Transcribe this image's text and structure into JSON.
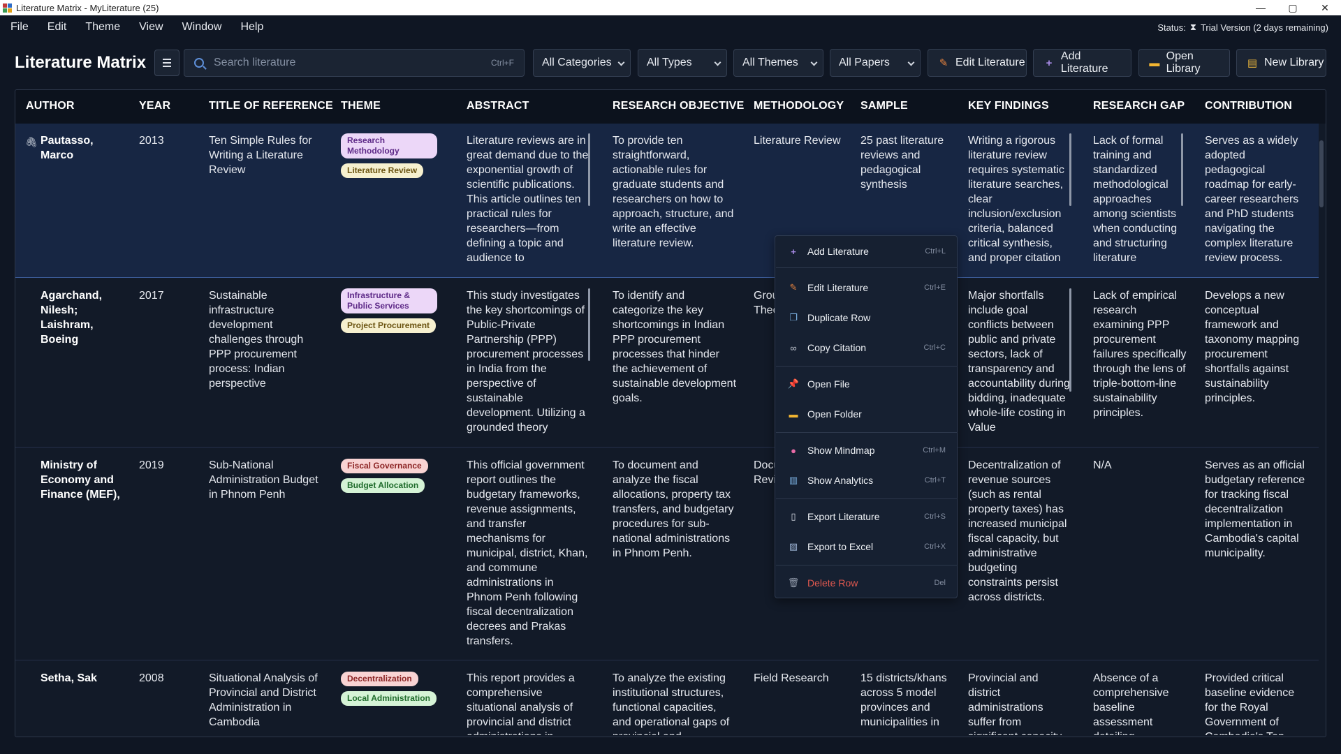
{
  "window": {
    "title": "Literature Matrix - MyLiterature (25)",
    "controls": {
      "minimize": "—",
      "maximize": "▢",
      "close": "✕"
    }
  },
  "menubar": {
    "items": [
      "File",
      "Edit",
      "Theme",
      "View",
      "Window",
      "Help"
    ],
    "status_label": "Status:",
    "status_value": "Trial Version (2 days remaining)"
  },
  "toolbar": {
    "title": "Literature Matrix",
    "search_placeholder": "Search literature",
    "search_shortcut": "Ctrl+F",
    "filters": [
      "All Categories",
      "All Types",
      "All Themes",
      "All Papers"
    ],
    "buttons": {
      "edit": "Edit Literature",
      "add": "Add Literature",
      "open_library": "Open Library",
      "new_library": "New Library"
    }
  },
  "table": {
    "headers": [
      "AUTHOR",
      "YEAR",
      "TITLE OF REFERENCE",
      "THEME",
      "ABSTRACT",
      "RESEARCH OBJECTIVE",
      "METHODOLOGY",
      "SAMPLE",
      "KEY FINDINGS",
      "RESEARCH GAP",
      "CONTRIBUTION"
    ],
    "rows": [
      {
        "author": "Pautasso, Marco",
        "year": "2013",
        "title": "Ten Simple Rules for Writing a Literature Review",
        "themes": [
          {
            "label": "Research Methodology",
            "color": "purple"
          },
          {
            "label": "Literature Review",
            "color": "cream"
          }
        ],
        "abstract": "Literature reviews are in great demand due to the exponential growth of scientific publications. This article outlines ten practical rules for researchers—from defining a topic and audience to",
        "objective": "To provide ten straightforward, actionable rules for graduate students and researchers on how to approach, structure, and write an effective literature review.",
        "methodology": "Literature Review",
        "sample": "25 past literature reviews and pedagogical synthesis",
        "findings": "Writing a rigorous literature review requires systematic literature searches, clear inclusion/exclusion criteria, balanced critical synthesis, and proper citation",
        "gap": "Lack of formal training and standardized methodological approaches among scientists when conducting and structuring literature",
        "contribution": "Serves as a widely adopted pedagogical roadmap for early-career researchers and PhD students navigating the complex literature review process."
      },
      {
        "author": "Agarchand, Nilesh; Laishram, Boeing",
        "year": "2017",
        "title": "Sustainable infrastructure development challenges through PPP procurement process: Indian perspective",
        "themes": [
          {
            "label": "Infrastructure & Public Services",
            "color": "purple"
          },
          {
            "label": "Project Procurement",
            "color": "cream"
          }
        ],
        "abstract": "This study investigates the key shortcomings of Public-Private Partnership (PPP) procurement processes in India from the perspective of sustainable development. Utilizing a grounded theory",
        "objective": "To identify and categorize the key shortcomings in Indian PPP procurement processes that hinder the achievement of sustainable development goals.",
        "methodology": "Grou Theo",
        "sample": "",
        "findings": "Major shortfalls include goal conflicts between public and private sectors, lack of transparency and accountability during bidding, inadequate whole-life costing in Value",
        "gap": "Lack of empirical research examining PPP procurement failures specifically through the lens of triple-bottom-line sustainability principles.",
        "contribution": "Develops a new conceptual framework and taxonomy mapping procurement shortfalls against sustainability principles."
      },
      {
        "author": "Ministry of Economy and Finance (MEF),",
        "year": "2019",
        "title": "Sub-National Administration Budget in Phnom Penh",
        "themes": [
          {
            "label": "Fiscal Governance",
            "color": "red"
          },
          {
            "label": "Budget Allocation",
            "color": "green"
          }
        ],
        "abstract": "This official government report outlines the budgetary frameworks, revenue assignments, and transfer mechanisms for municipal, district, Khan, and commune administrations in Phnom Penh following fiscal decentralization decrees and Prakas transfers.",
        "objective": "To document and analyze the fiscal allocations, property tax transfers, and budgetary procedures for sub-national administrations in Phnom Penh.",
        "methodology": "Docu Revi",
        "sample": "",
        "findings": "Decentralization of revenue sources (such as rental property taxes) has increased municipal fiscal capacity, but administrative budgeting constraints persist across districts.",
        "gap": "N/A",
        "contribution": "Serves as an official budgetary reference for tracking fiscal decentralization implementation in Cambodia's capital municipality."
      },
      {
        "author": "Setha, Sak",
        "year": "2008",
        "title": "Situational Analysis of Provincial and District Administration in Cambodia",
        "themes": [
          {
            "label": "Decentralization",
            "color": "red"
          },
          {
            "label": "Local Administration",
            "color": "green"
          }
        ],
        "abstract": "This report provides a comprehensive situational analysis of provincial and district administrations in",
        "objective": "To analyze the existing institutional structures, functional capacities, and operational gaps of provincial and",
        "methodology": "Field Research",
        "sample": "15 districts/khans across 5 model provinces and municipalities in",
        "findings": "Provincial and district administrations suffer from significant capacity",
        "gap": "Absence of a comprehensive baseline assessment detailing",
        "contribution": "Provided critical baseline evidence for the Royal Government of Cambodia's Top"
      }
    ]
  },
  "context_menu": {
    "items": [
      {
        "label": "Add Literature",
        "shortcut": "Ctrl+L",
        "icon": "plus-icon"
      },
      {
        "label": "Edit Literature",
        "shortcut": "Ctrl+E",
        "icon": "pencil-icon"
      },
      {
        "label": "Duplicate Row",
        "shortcut": "",
        "icon": "duplicate-icon"
      },
      {
        "label": "Copy Citation",
        "shortcut": "Ctrl+C",
        "icon": "link-icon"
      },
      {
        "label": "Open File",
        "shortcut": "",
        "icon": "pin-icon"
      },
      {
        "label": "Open Folder",
        "shortcut": "",
        "icon": "folder-icon"
      },
      {
        "label": "Show Mindmap",
        "shortcut": "Ctrl+M",
        "icon": "mindmap-icon"
      },
      {
        "label": "Show Analytics",
        "shortcut": "Ctrl+T",
        "icon": "chart-icon"
      },
      {
        "label": "Export Literature",
        "shortcut": "Ctrl+S",
        "icon": "document-icon"
      },
      {
        "label": "Export to Excel",
        "shortcut": "Ctrl+X",
        "icon": "spreadsheet-icon"
      },
      {
        "label": "Delete Row",
        "shortcut": "Del",
        "icon": "trash-icon"
      }
    ]
  },
  "colors": {
    "background": "#0f1623",
    "selected_row": "#172643",
    "accent": "#5e8fd8",
    "danger": "#e0584f"
  }
}
